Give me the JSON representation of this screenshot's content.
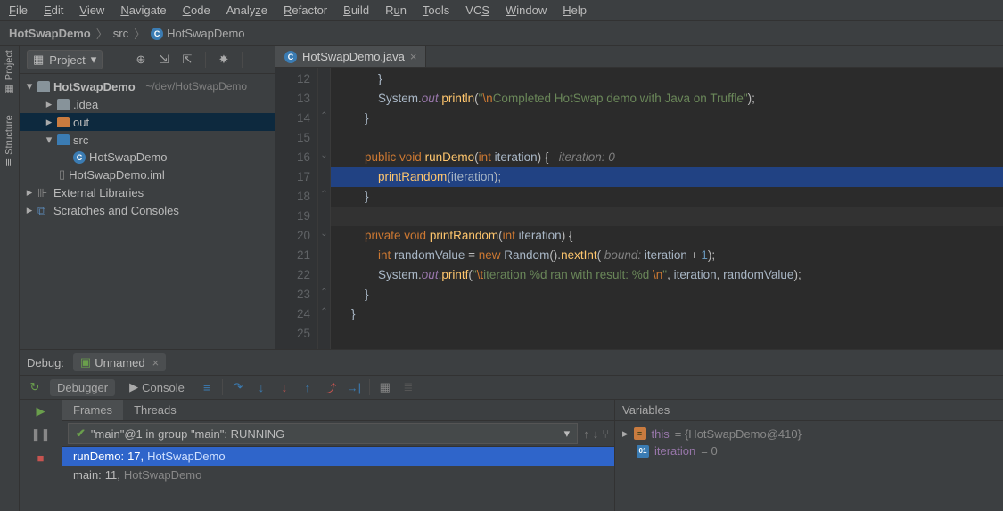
{
  "menu": [
    "File",
    "Edit",
    "View",
    "Navigate",
    "Code",
    "Analyze",
    "Refactor",
    "Build",
    "Run",
    "Tools",
    "VCS",
    "Window",
    "Help"
  ],
  "breadcrumb": {
    "items": [
      "HotSwapDemo",
      "src",
      "HotSwapDemo"
    ]
  },
  "project_dropdown": "Project",
  "tree": {
    "root": {
      "name": "HotSwapDemo",
      "path": "~/dev/HotSwapDemo"
    },
    "idea": ".idea",
    "out": "out",
    "src": "src",
    "class": "HotSwapDemo",
    "iml": "HotSwapDemo.iml",
    "libs": "External Libraries",
    "scratches": "Scratches and Consoles"
  },
  "editor": {
    "tab": "HotSwapDemo.java",
    "lines_start": 12,
    "lines_end": 25,
    "hint_iteration": "iteration: 0",
    "hint_bound": "bound:",
    "code": {
      "l13_str": "\"\\nCompleted HotSwap demo with Java on Truffle\"",
      "l16_sig": "public void runDemo(int iteration) {",
      "l17": "printRandom(iteration);",
      "l20_sig": "private void printRandom(int iteration) {",
      "l21": "int randomValue = new Random().nextInt( bound: iteration + 1);",
      "l22_str": "\"\\titeration %d ran with result: %d \\n\"",
      "l22_tail": ", iteration, randomValue);"
    }
  },
  "debug": {
    "title": "Debug:",
    "config": "Unnamed",
    "tabs": {
      "debugger": "Debugger",
      "console": "Console"
    },
    "frames_tabs": {
      "frames": "Frames",
      "threads": "Threads"
    },
    "thread_selector": "\"main\"@1 in group \"main\": RUNNING",
    "stack": [
      {
        "method": "runDemo:",
        "line": "17,",
        "cls": " HotSwapDemo"
      },
      {
        "method": "main:",
        "line": "11,",
        "cls": " HotSwapDemo"
      }
    ],
    "vars_title": "Variables",
    "vars": [
      {
        "name": "this",
        "val": " = {HotSwapDemo@410}"
      },
      {
        "name": "iteration",
        "val": " = 0"
      }
    ]
  },
  "rail": {
    "project": "Project",
    "structure": "Structure"
  }
}
